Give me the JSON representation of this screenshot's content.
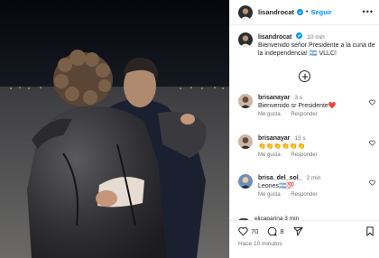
{
  "header": {
    "username": "lisandrocat",
    "separator": "•",
    "follow_label": "Seguir",
    "more_label": "•••"
  },
  "caption": {
    "username": "lisandrocat",
    "time": "10 min",
    "text": "Bienvenido señor Presidente a la cuna de la independencia! 🇦🇷 VLLC!"
  },
  "add_comment_icon": "plus-circle-icon",
  "comments": [
    {
      "username": "brisanayar",
      "time": "3 s",
      "text": "Bienvenido sr Presidente❤️",
      "like_label": "Me gusta",
      "reply_label": "Responder"
    },
    {
      "username": "brisanayar",
      "time": "13 s",
      "text": "👏👏👏👏👏👏",
      "like_label": "Me gusta",
      "reply_label": "Responder"
    },
    {
      "username": "brisa_del_sol_",
      "time": "2 min",
      "text": "Leones🇦🇷💯",
      "like_label": "Me gusta",
      "reply_label": "Responder"
    }
  ],
  "partial_comment": "elicaparina 3 min",
  "actions": {
    "likes": "70",
    "comments": "8",
    "posted_ago": "Hace 10 minutos"
  },
  "colors": {
    "accent": "#0095f6",
    "muted": "#737373",
    "heart": "#ed4956"
  }
}
